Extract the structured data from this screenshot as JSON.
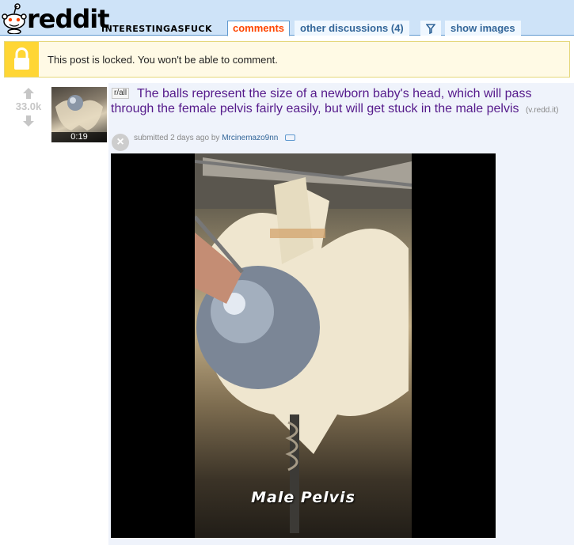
{
  "header": {
    "wordmark": "reddit",
    "subreddit": "INTERESTINGASFUCK",
    "tabs": {
      "comments": "comments",
      "other_discussions": "other discussions (4)",
      "filter_icon": "filter-icon",
      "show_images": "show images"
    }
  },
  "locked_banner": {
    "icon": "lock-icon",
    "text": "This post is locked. You won't be able to comment."
  },
  "post": {
    "score": "33.0k",
    "thumbnail_duration": "0:19",
    "flair": "r/all",
    "title": "The balls represent the size of a newborn baby's head, which will pass through the female pelvis fairly easily, but will get stuck in the male pelvis",
    "domain": "(v.redd.it)",
    "tagline_prefix": "submitted 2 days ago by",
    "author": "Mrcinemazo9nn",
    "video_caption": "Male Pelvis"
  },
  "colors": {
    "header_bg": "#cee3f8",
    "tab_active": "#ff4500",
    "title": "#551a8b",
    "lock_yellow": "#ffd635"
  }
}
